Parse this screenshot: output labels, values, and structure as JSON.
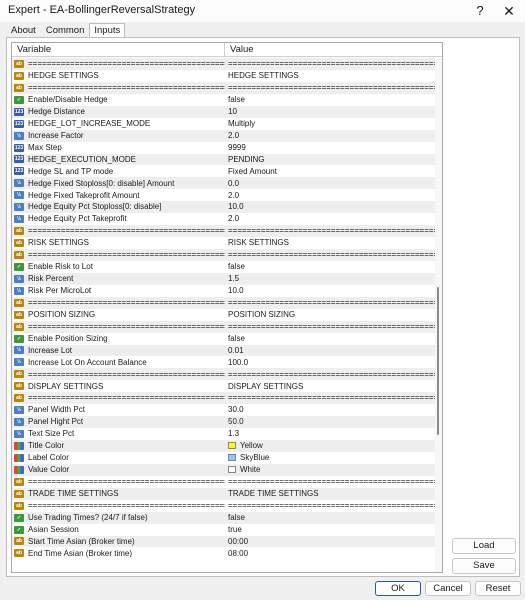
{
  "window": {
    "title": "Expert - EA-BollingerReversalStrategy",
    "help_label": "?",
    "close_label": "✕"
  },
  "tabs": [
    {
      "label": "About",
      "active": false
    },
    {
      "label": "Common",
      "active": false
    },
    {
      "label": "Inputs",
      "active": true
    }
  ],
  "grid": {
    "columns": [
      "Variable",
      "Value"
    ],
    "rows": [
      {
        "icon": "ab",
        "name": "==============================================",
        "value": "=============================================="
      },
      {
        "icon": "ab",
        "name": "HEDGE SETTINGS",
        "value": "HEDGE SETTINGS"
      },
      {
        "icon": "ab",
        "name": "==============================================",
        "value": "=============================================="
      },
      {
        "icon": "bool",
        "name": "Enable/Disable Hedge",
        "value": "false"
      },
      {
        "icon": "v123",
        "name": "Hedge Distance",
        "value": "10"
      },
      {
        "icon": "enum",
        "name": "HEDGE_LOT_INCREASE_MODE",
        "value": "Multiply"
      },
      {
        "icon": "half",
        "name": "Increase Factor",
        "value": "2.0"
      },
      {
        "icon": "v123",
        "name": "Max Step",
        "value": "9999"
      },
      {
        "icon": "enum",
        "name": "HEDGE_EXECUTION_MODE",
        "value": "PENDING"
      },
      {
        "icon": "enum",
        "name": "Hedge SL and TP mode",
        "value": "Fixed Amount"
      },
      {
        "icon": "half",
        "name": "Hedge Fixed Stoploss[0: disable] Amount",
        "value": "0.0"
      },
      {
        "icon": "half",
        "name": "Hedge Fixed Takeprofit Amount",
        "value": "2.0"
      },
      {
        "icon": "half",
        "name": "Hedge Equity Pct Stoploss[0: disable]",
        "value": "10.0"
      },
      {
        "icon": "half",
        "name": "Hedge Equity Pct Takeprofit",
        "value": "2.0"
      },
      {
        "icon": "ab",
        "name": "==============================================",
        "value": "=============================================="
      },
      {
        "icon": "ab",
        "name": "RISK SETTINGS",
        "value": "RISK SETTINGS"
      },
      {
        "icon": "ab",
        "name": "==============================================",
        "value": "=============================================="
      },
      {
        "icon": "bool",
        "name": "Enable Risk to Lot",
        "value": "false"
      },
      {
        "icon": "half",
        "name": "Risk Percent",
        "value": "1.5"
      },
      {
        "icon": "half",
        "name": "Risk Per MicroLot",
        "value": "10.0"
      },
      {
        "icon": "ab",
        "name": "==============================================",
        "value": "=============================================="
      },
      {
        "icon": "ab",
        "name": "POSITION SIZING",
        "value": "POSITION SIZING"
      },
      {
        "icon": "ab",
        "name": "==============================================",
        "value": "=============================================="
      },
      {
        "icon": "bool",
        "name": "Enable Position Sizing",
        "value": "false"
      },
      {
        "icon": "half",
        "name": "Increase Lot",
        "value": "0.01"
      },
      {
        "icon": "half",
        "name": "Increase Lot On Account Balance",
        "value": "100.0"
      },
      {
        "icon": "ab",
        "name": "==============================================",
        "value": "=============================================="
      },
      {
        "icon": "ab",
        "name": "DISPLAY SETTINGS",
        "value": "DISPLAY SETTINGS"
      },
      {
        "icon": "ab",
        "name": "==============================================",
        "value": "=============================================="
      },
      {
        "icon": "half",
        "name": "Panel Width Pct",
        "value": "30.0"
      },
      {
        "icon": "half",
        "name": "Panel Hight Pct",
        "value": "50.0"
      },
      {
        "icon": "half",
        "name": "Text Size Pct",
        "value": "1.3"
      },
      {
        "icon": "color",
        "name": "Title Color",
        "value": "Yellow",
        "swatch": "#ffff00"
      },
      {
        "icon": "color",
        "name": "Label Color",
        "value": "SkyBlue",
        "swatch": "#87ceeb"
      },
      {
        "icon": "color",
        "name": "Value Color",
        "value": "White",
        "swatch": "#ffffff"
      },
      {
        "icon": "ab",
        "name": "==============================================",
        "value": "=============================================="
      },
      {
        "icon": "ab",
        "name": "TRADE TIME SETTINGS",
        "value": "TRADE TIME SETTINGS"
      },
      {
        "icon": "ab",
        "name": "==============================================",
        "value": "=============================================="
      },
      {
        "icon": "bool",
        "name": "Use Trading Times? (24/7 if false)",
        "value": "false"
      },
      {
        "icon": "bool",
        "name": "Asian Session",
        "value": "true"
      },
      {
        "icon": "ab",
        "name": "Start Time Asian (Broker time)",
        "value": "00:00"
      },
      {
        "icon": "ab",
        "name": "End Time Asian (Broker time)",
        "value": "08:00"
      }
    ]
  },
  "side_buttons": {
    "load": "Load",
    "save": "Save"
  },
  "buttons": {
    "ok": "OK",
    "cancel": "Cancel",
    "reset": "Reset"
  }
}
